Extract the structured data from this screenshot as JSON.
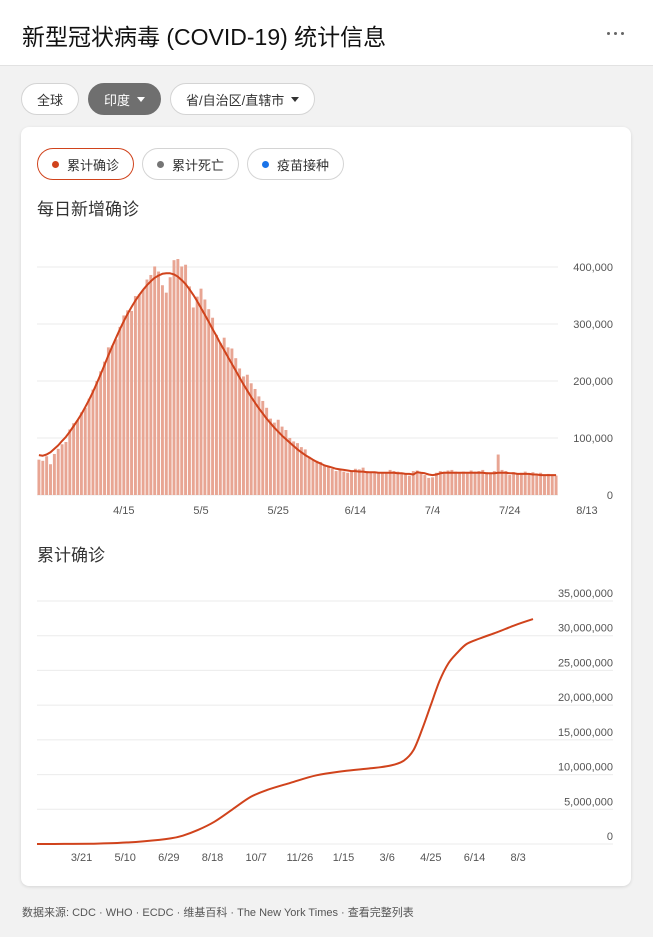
{
  "header": {
    "title": "新型冠状病毒 (COVID-19) 统计信息"
  },
  "filters": [
    {
      "label": "全球",
      "active": false,
      "dropdown": false
    },
    {
      "label": "印度",
      "active": true,
      "dropdown": true
    },
    {
      "label": "省/自治区/直辖市",
      "active": false,
      "dropdown": true
    }
  ],
  "metric_tabs": [
    {
      "label": "累计确诊",
      "color": "#d0431c",
      "active": true
    },
    {
      "label": "累计死亡",
      "color": "#757575",
      "active": false
    },
    {
      "label": "疫苗接种",
      "color": "#1a73e8",
      "active": false
    }
  ],
  "colors": {
    "accent": "#d0431c",
    "bar": "#e8a593",
    "grid": "#ebebeb"
  },
  "chart_data": [
    {
      "type": "bar",
      "title": "每日新增确诊",
      "y_axis_position": "right",
      "ylim": [
        0,
        400000
      ],
      "yticks": [
        0,
        100000,
        200000,
        300000,
        400000
      ],
      "ytick_labels": [
        "0",
        "100,000",
        "200,000",
        "300,000",
        "400,000"
      ],
      "xticks": [
        "4/15",
        "5/5",
        "5/25",
        "6/14",
        "7/4",
        "7/24",
        "8/13"
      ],
      "x_start": "3/24",
      "x_end": "8/21",
      "series": [
        {
          "type": "bar",
          "values": [
            62000,
            60000,
            68000,
            54000,
            72000,
            81000,
            89000,
            93000,
            115000,
            126000,
            131000,
            145000,
            153000,
            169000,
            185000,
            200000,
            217000,
            234000,
            259000,
            262000,
            273000,
            295000,
            315000,
            324000,
            323000,
            349000,
            352000,
            360000,
            378000,
            386000,
            401000,
            392000,
            368000,
            355000,
            382000,
            412000,
            414000,
            401000,
            404000,
            366000,
            329000,
            348000,
            362000,
            343000,
            326000,
            311000,
            281000,
            267000,
            276000,
            259000,
            257000,
            240000,
            222000,
            208000,
            211000,
            196000,
            186000,
            173000,
            165000,
            153000,
            134000,
            127000,
            132000,
            120000,
            114000,
            100000,
            94000,
            91000,
            84000,
            80000,
            67000,
            62000,
            60000,
            58000,
            53000,
            50000,
            46000,
            42000,
            44000,
            41000,
            39000,
            43000,
            46000,
            45000,
            48000,
            42000,
            40000,
            41000,
            39000,
            38000,
            40000,
            44000,
            42000,
            41000,
            39000,
            38000,
            34000,
            42000,
            43000,
            40000,
            35000,
            30000,
            31000,
            39000,
            42000,
            41000,
            43000,
            44000,
            41000,
            39000,
            41000,
            40000,
            43000,
            41000,
            42000,
            44000,
            40000,
            38000,
            42000,
            71000,
            44000,
            42000,
            35000,
            40000,
            36000,
            39000,
            41000,
            38000,
            40000,
            36000,
            39000,
            35000,
            37000,
            36000,
            34000
          ]
        },
        {
          "type": "line",
          "values": [
            70000,
            69000,
            71000,
            75000,
            81000,
            87000,
            95000,
            102000,
            111000,
            121000,
            131000,
            142000,
            154000,
            167000,
            181000,
            196000,
            212000,
            228000,
            245000,
            261000,
            276000,
            291000,
            305000,
            318000,
            330000,
            341000,
            351000,
            360000,
            368000,
            375000,
            381000,
            385000,
            388000,
            389000,
            389000,
            387000,
            383000,
            377000,
            370000,
            361000,
            351000,
            340000,
            328000,
            316000,
            304000,
            291000,
            279000,
            266000,
            254000,
            242000,
            230000,
            218000,
            206000,
            194000,
            183000,
            172000,
            162000,
            152000,
            143000,
            134000,
            126000,
            118000,
            111000,
            104000,
            98000,
            92000,
            86000,
            80000,
            75000,
            70000,
            66000,
            62000,
            58000,
            55000,
            52000,
            50000,
            48000,
            46000,
            45000,
            44000,
            43000,
            42000,
            42000,
            41000,
            41000,
            40000,
            40000,
            40000,
            39000,
            39000,
            39000,
            39000,
            39000,
            38000,
            38000,
            37000,
            37000,
            36000,
            40000,
            39000,
            38000,
            36000,
            35000,
            36000,
            38000,
            39000,
            39000,
            39000,
            39000,
            39000,
            39000,
            39000,
            39000,
            39000,
            39000,
            39000,
            38000,
            38000,
            38000,
            39000,
            39000,
            39000,
            38000,
            38000,
            37000,
            37000,
            37000,
            37000,
            36000,
            36000,
            35000,
            35000,
            35000,
            35000,
            35000
          ]
        }
      ]
    },
    {
      "type": "line",
      "title": "累计确诊",
      "y_axis_position": "right",
      "ylim": [
        0,
        35000000
      ],
      "yticks": [
        0,
        5000000,
        10000000,
        15000000,
        20000000,
        25000000,
        30000000,
        35000000
      ],
      "ytick_labels": [
        "0",
        "5,000,000",
        "10,000,000",
        "15,000,000",
        "20,000,000",
        "25,000,000",
        "30,000,000",
        "35,000,000"
      ],
      "xticks": [
        "3/21",
        "5/10",
        "6/29",
        "8/18",
        "10/7",
        "11/26",
        "1/15",
        "3/6",
        "4/25",
        "6/14",
        "8/3"
      ],
      "series": [
        {
          "x": [
            "2020-01-30",
            "2020-03-01",
            "2020-04-01",
            "2020-05-01",
            "2020-06-01",
            "2020-07-01",
            "2020-07-15",
            "2020-08-01",
            "2020-08-20",
            "2020-09-10",
            "2020-10-01",
            "2020-10-20",
            "2020-11-15",
            "2020-12-15",
            "2021-01-15",
            "2021-02-15",
            "2021-03-10",
            "2021-03-25",
            "2021-04-05",
            "2021-04-15",
            "2021-04-25",
            "2021-05-05",
            "2021-05-15",
            "2021-05-25",
            "2021-06-05",
            "2021-06-20",
            "2021-07-10",
            "2021-07-30",
            "2021-08-20"
          ],
          "values": [
            0,
            10000,
            50000,
            150000,
            400000,
            800000,
            1200000,
            2000000,
            3200000,
            5000000,
            6800000,
            7800000,
            8800000,
            9900000,
            10500000,
            10900000,
            11300000,
            12000000,
            13500000,
            16500000,
            20000000,
            23500000,
            26000000,
            27500000,
            28800000,
            29600000,
            30500000,
            31500000,
            32400000
          ]
        }
      ]
    }
  ],
  "footer": {
    "text": "数据来源: CDC · WHO · ECDC · 维基百科 · The New York Times · 查看完整列表"
  }
}
